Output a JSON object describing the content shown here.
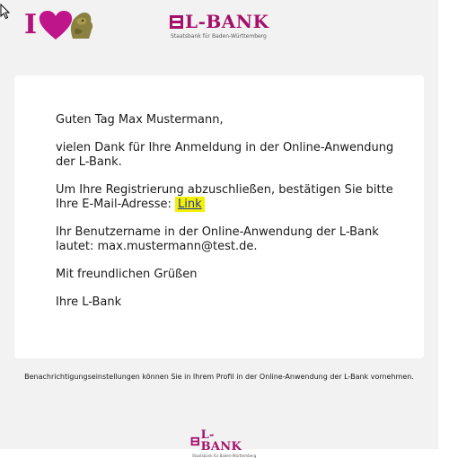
{
  "header": {
    "i_letter": "I",
    "brand_name": "L-BANK",
    "brand_tagline": "Staatsbank für Baden-Württemberg"
  },
  "email": {
    "greeting": "Guten Tag Max Mustermann,",
    "thanks": "vielen Dank für Ihre Anmeldung in der Online-Anwendung der L-Bank.",
    "confirm_text": "Um Ihre Registrierung abzuschließen, bestätigen Sie bitte Ihre E-Mail-Adresse:",
    "confirm_link": "Link",
    "username_text": "Ihr Benutzername in der Online-Anwendung der L-Bank lautet: max.mustermann@test.de.",
    "closing": "Mit freundlichen Grüßen",
    "signature": "Ihre L-Bank"
  },
  "footer": {
    "note": "Benachrichtigungseinstellungen können Sie in Ihrem Profil in der Online-Anwendung der L-Bank vornehmen.",
    "brand_name": "L-BANK",
    "brand_tagline": "Staatsbank für Baden-Württemberg"
  },
  "colors": {
    "brand": "#a4106a",
    "link_highlight": "#f3f000",
    "link_text": "#1a33b5",
    "background": "#f2f2f2"
  }
}
